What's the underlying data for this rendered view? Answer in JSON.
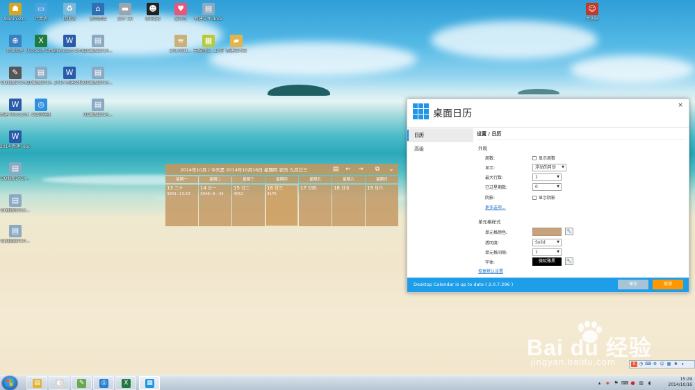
{
  "colors": {
    "accent_blue": "#1e9ee8",
    "cancel_orange": "#ff9700",
    "save_disabled": "#a7c3d6",
    "calendar_tan": "#c4965f",
    "cell_color_swatch": "#c6a27d"
  },
  "desktop_icons": [
    {
      "label": "Administr...",
      "icon": "user-folder-icon"
    },
    {
      "label": "计算机",
      "icon": "computer-icon"
    },
    {
      "label": "回收站",
      "icon": "recycle-bin-icon"
    },
    {
      "label": "宽带连接",
      "icon": "network-icon"
    },
    {
      "label": "文件 (3)",
      "icon": "drive-icon"
    },
    {
      "label": "腾讯QQ",
      "icon": "qq-penguin-icon"
    },
    {
      "label": "爱奇艺",
      "icon": "heart-icon"
    },
    {
      "label": "新建文件.docx",
      "icon": "image-file-icon"
    },
    {
      "label": "网络邻居",
      "icon": "network-places-icon"
    },
    {
      "label": "Microsoft Office Exc...",
      "icon": "excel-icon"
    },
    {
      "label": "Microsoft Office Wo...",
      "icon": "word-icon"
    },
    {
      "label": "QQ截图2014...",
      "icon": "image-file-icon"
    },
    {
      "label": "2014091...",
      "icon": "text-file-icon"
    },
    {
      "label": "无线网络...工作表.xlsx",
      "icon": "spreadsheet-icon"
    },
    {
      "label": "新建文件夹",
      "icon": "folder-icon"
    },
    {
      "label": "QQ截图2014...",
      "icon": "pen-icon"
    },
    {
      "label": "QQ截图2014...",
      "icon": "image-file-icon"
    },
    {
      "label": "2014 新建文档...",
      "icon": "word-icon"
    },
    {
      "label": "QQ截图2014...",
      "icon": "image-file-icon"
    },
    {
      "label": "新建 Microsoft ...",
      "icon": "word-icon"
    },
    {
      "label": "QQ浏览器",
      "icon": "browser-icon"
    },
    {
      "label": "QQ截图2014...",
      "icon": "image-file-icon"
    },
    {
      "label": "2014 新建 .docx",
      "icon": "word-icon"
    },
    {
      "label": "QQ截图2014...",
      "icon": "image-file-icon"
    },
    {
      "label": "QQ截图2014...",
      "icon": "image-file-icon"
    },
    {
      "label": "QQ截图2014...",
      "icon": "image-file-icon"
    },
    {
      "label": "大头贴",
      "icon": "bear-icon"
    }
  ],
  "watermark": {
    "logo": "Bai du 经验",
    "url": "jingyan.baidu.com"
  },
  "calendar": {
    "title": "2014年10月 / 今天是 2014年10月16日 星期四 农历 九月廿三",
    "weekdays": [
      "星期一",
      "星期二",
      "星期三",
      "星期四",
      "星期五",
      "星期六",
      "星期日"
    ],
    "days": [
      {
        "num": "13",
        "lunar": "二十",
        "event": "3801--13:53"
      },
      {
        "num": "14",
        "lunar": "廿一",
        "event": "3946--8 : 34"
      },
      {
        "num": "15",
        "lunar": "廿二",
        "event": "4052"
      },
      {
        "num": "16",
        "lunar": "廿三",
        "event": "4175"
      },
      {
        "num": "17",
        "lunar": "廿四",
        "event": ""
      },
      {
        "num": "18",
        "lunar": "廿五",
        "event": ""
      },
      {
        "num": "19",
        "lunar": "廿六",
        "event": ""
      }
    ]
  },
  "dialog": {
    "title": "桌面日历",
    "close": "×",
    "sidebar": [
      {
        "label": "日历",
        "active": true
      },
      {
        "label": "高级",
        "active": false
      }
    ],
    "breadcrumb": "设置 / 日历",
    "appearance": {
      "section": "外观",
      "weeks_label": "周数:",
      "weeks_check": "显示周数",
      "display_label": "显示:",
      "display_value": "浮动的月份",
      "max_rows_label": "最大行数:",
      "max_rows_value": "1",
      "past_weeks_label": "已过星期数:",
      "past_weeks_value": "0",
      "shadow_label": "阴影:",
      "shadow_check": "显示阴影",
      "more_link": "更多选项..."
    },
    "cell_style": {
      "section": "单元格样式",
      "color_label": "单元格颜色:",
      "transparency_label": "透明度:",
      "transparency_value": "Solid",
      "spacing_label": "单元格间隙:",
      "spacing_value": "1",
      "font_label": "字体:",
      "font_value": "微软雅黑",
      "pick_glyph": "🔧",
      "default_link": "恢复默认设置"
    },
    "footer": {
      "status": "Desktop Calendar is up to date ( 2.0.7.296 )",
      "save": "保存",
      "cancel": "取消"
    }
  },
  "taskbar": {
    "apps": [
      {
        "icon": "file-explorer-icon",
        "color": "#e2b23a",
        "glyph": "▤"
      },
      {
        "icon": "media-player-icon",
        "color": "#d8d8d8",
        "glyph": "◐"
      },
      {
        "icon": "paint-icon",
        "color": "#6aa84f",
        "glyph": "✎"
      },
      {
        "icon": "browser-icon",
        "color": "#2a7fd0",
        "glyph": "◎"
      },
      {
        "icon": "excel-icon",
        "color": "#1f7a3e",
        "glyph": "X"
      },
      {
        "icon": "desktop-calendar-icon",
        "color": "#2196e6",
        "glyph": "▦"
      }
    ],
    "clock_time": "15:29",
    "clock_date": "2014/10/16"
  }
}
